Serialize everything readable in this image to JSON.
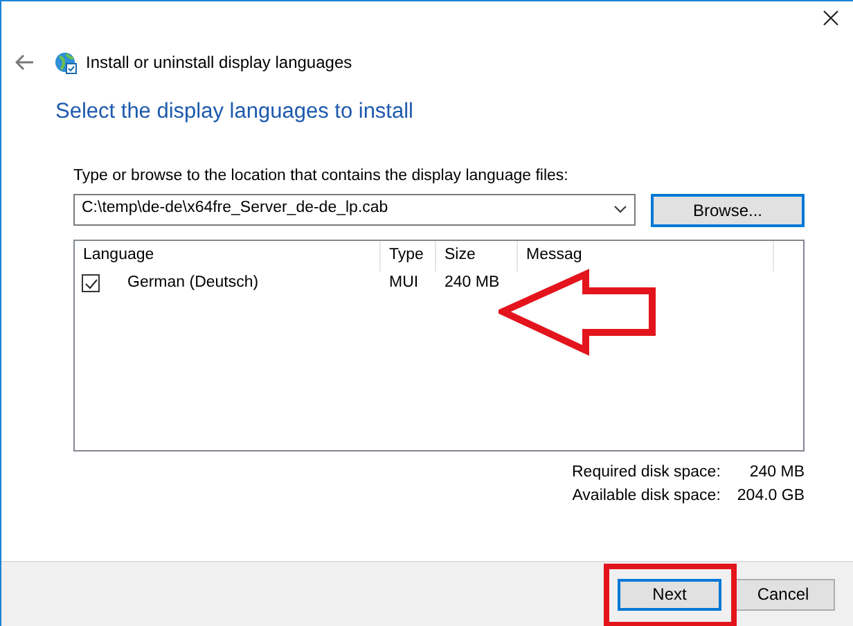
{
  "window": {
    "title": "Install or uninstall display languages"
  },
  "heading": "Select the display languages to install",
  "location": {
    "label": "Type or browse to the location that contains the display language files:",
    "value": "C:\\temp\\de-de\\x64fre_Server_de-de_lp.cab",
    "browse_button": "Browse..."
  },
  "table": {
    "columns": [
      "Language",
      "Type",
      "Size",
      "Messag"
    ],
    "rows": [
      {
        "checked": true,
        "language": "German (Deutsch)",
        "type": "MUI",
        "size": "240 MB"
      }
    ]
  },
  "disk_space": [
    {
      "label": "Required disk space:",
      "value": "240 MB"
    },
    {
      "label": "Available disk space:",
      "value": "204.0 GB"
    }
  ],
  "buttons": [
    {
      "label": "Next",
      "default": true
    },
    {
      "label": "Cancel",
      "default": false
    }
  ]
}
